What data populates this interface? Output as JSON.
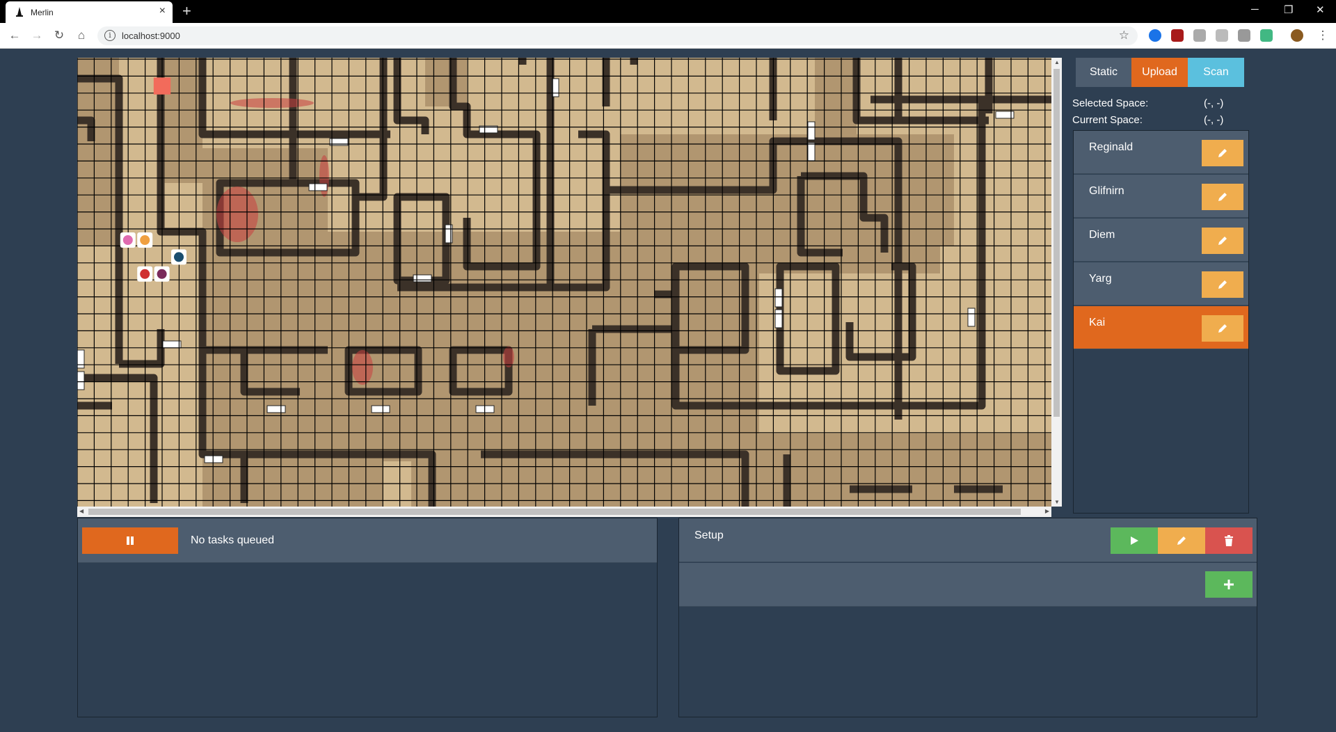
{
  "browser": {
    "tab_title": "Merlin",
    "url": "localhost:9000",
    "new_tab": "+",
    "tab_close": "×",
    "win_minimize": "─",
    "win_restore": "❐",
    "win_close": "✕"
  },
  "map": {
    "grid_columns": 46,
    "grid_rows": 21,
    "highlighted_cell": {
      "col": 2,
      "row": 1
    },
    "tokens": [
      {
        "name": "gem-token",
        "col": 2,
        "row": 10,
        "color": "#e06bb0"
      },
      {
        "name": "hands-token",
        "col": 3,
        "row": 10,
        "color": "#f0a040"
      },
      {
        "name": "wizard-hat-token",
        "col": 5,
        "row": 11,
        "color": "#1a4d6e"
      },
      {
        "name": "hammer-token",
        "col": 3,
        "row": 12,
        "color": "#d03030"
      },
      {
        "name": "ankh-token",
        "col": 4,
        "row": 12,
        "color": "#7a2a5a"
      }
    ]
  },
  "mode_bar": {
    "static_label": "Static",
    "upload_label": "Upload",
    "scan_label": "Scan",
    "colors": {
      "static": "#4d5d6f",
      "upload": "#e0681e",
      "scan": "#5bc0de"
    }
  },
  "spaces": {
    "selected_label": "Selected Space:",
    "selected_value": "(-, -)",
    "current_label": "Current Space:",
    "current_value": "(-, -)"
  },
  "characters": [
    {
      "name": "Reginald",
      "active": false
    },
    {
      "name": "Glifnirn",
      "active": false
    },
    {
      "name": "Diem",
      "active": false
    },
    {
      "name": "Yarg",
      "active": false
    },
    {
      "name": "Kai",
      "active": true
    }
  ],
  "tasks": {
    "status_text": "No tasks queued",
    "pause_icon": "pause-icon"
  },
  "setup": {
    "label": "Setup",
    "play_icon": "play-icon",
    "edit_icon": "pencil-icon",
    "delete_icon": "trash-icon",
    "add_icon": "plus-icon",
    "colors": {
      "play": "#5cb85c",
      "edit": "#f0ad4e",
      "delete": "#d9534f",
      "add": "#5cb85c"
    }
  }
}
